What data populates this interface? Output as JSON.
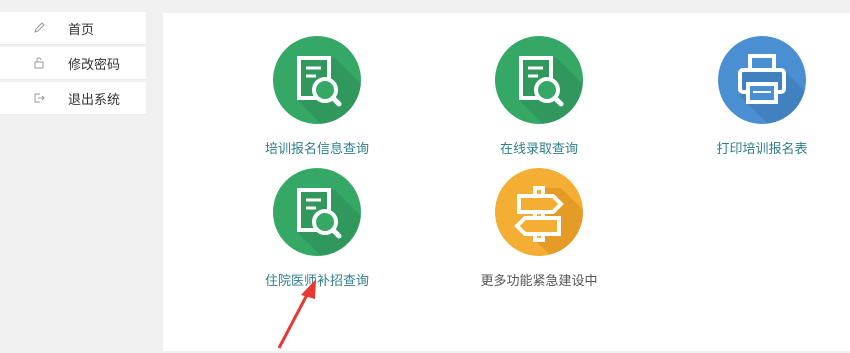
{
  "sidebar": {
    "items": [
      {
        "label": "首页",
        "icon": "pencil-icon"
      },
      {
        "label": "修改密码",
        "icon": "lock-icon"
      },
      {
        "label": "退出系统",
        "icon": "logout-icon"
      }
    ]
  },
  "main": {
    "tiles": [
      {
        "label": "培训报名信息查询",
        "icon": "document-search-icon",
        "color": "#3aaa6a"
      },
      {
        "label": "在线录取查询",
        "icon": "document-search-icon",
        "color": "#3aaa6a"
      },
      {
        "label": "打印培训报名表",
        "icon": "printer-icon",
        "color": "#4a8fd1"
      },
      {
        "label": "住院医师补招查询",
        "icon": "document-search-icon",
        "color": "#3aaa6a"
      },
      {
        "label": "更多功能紧急建设中",
        "icon": "signpost-icon",
        "color": "#f3ae33"
      }
    ]
  },
  "colors": {
    "tile_label": "#2f7f8b",
    "tile_label_muted": "#555555",
    "annotation_arrow": "#e53935"
  }
}
